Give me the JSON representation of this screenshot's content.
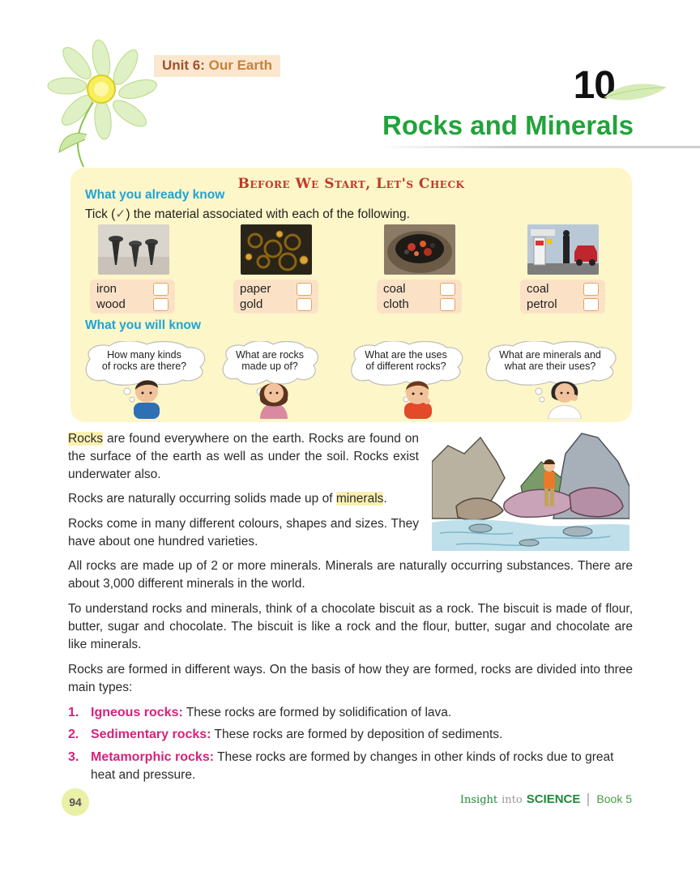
{
  "header": {
    "unit_label": "Unit 6:",
    "unit_name": "Our Earth",
    "chapter_number": "10",
    "chapter_title": "Rocks and Minerals"
  },
  "check_section": {
    "heading": "Before We Start, Let's Check",
    "already_know_heading": "What you already know",
    "instruction_before": "Tick (",
    "instruction_tick": "✓",
    "instruction_after": ") the material associated with each of the following.",
    "items": [
      {
        "options": [
          "iron",
          "wood"
        ],
        "photo_icon": "nails-photo-icon"
      },
      {
        "options": [
          "paper",
          "gold"
        ],
        "photo_icon": "jewellery-photo-icon"
      },
      {
        "options": [
          "coal",
          "cloth"
        ],
        "photo_icon": "coal-stove-photo-icon"
      },
      {
        "options": [
          "coal",
          "petrol"
        ],
        "photo_icon": "fuel-pump-photo-icon"
      }
    ],
    "will_know_heading": "What you will know",
    "questions": [
      {
        "line1": "How many kinds",
        "line2": "of rocks are there?"
      },
      {
        "line1": "What are rocks",
        "line2": "made up of?"
      },
      {
        "line1": "What are the uses",
        "line2": "of different rocks?"
      },
      {
        "line1": "What are minerals and",
        "line2": "what are their uses?"
      }
    ]
  },
  "body": {
    "p1_term": "Rocks",
    "p1_rest": " are found everywhere on the earth. Rocks are found on the surface of the earth as well as under the soil. Rocks exist underwater also.",
    "p2_before": "Rocks are naturally occurring solids made up of ",
    "p2_term": "minerals",
    "p2_after": ".",
    "p3": "Rocks come in many different colours, shapes and sizes. They have about one hundred varieties.",
    "p4": "All rocks are made up of 2 or more minerals. Minerals are naturally occurring substances. There are about 3,000 different minerals in the world.",
    "p5": "To understand rocks and minerals, think of a chocolate biscuit as a rock. The biscuit is made of flour, butter, sugar and chocolate. The biscuit is like a rock and the flour, butter, sugar and chocolate are like minerals.",
    "p6": "Rocks are formed in different ways. On the basis of how they are formed, rocks are divided into three main types:",
    "types": [
      {
        "num": "1.",
        "term": "Igneous rocks:",
        "desc": " These rocks are formed by solidification of lava."
      },
      {
        "num": "2.",
        "term": "Sedimentary rocks:",
        "desc": " These rocks are formed by deposition of sediments."
      },
      {
        "num": "3.",
        "term": "Metamorphic rocks:",
        "desc": " These rocks are formed by changes in other kinds of rocks due to great heat and pressure."
      }
    ]
  },
  "footer": {
    "page_number": "94",
    "series_1": "Insight",
    "series_2": "into",
    "series_3": "SCIENCE",
    "book": "Book 5"
  },
  "colors": {
    "title_green": "#22a33a",
    "heading_red": "#c0392b",
    "heading_blue": "#1fa3d7",
    "term_magenta": "#d6237a",
    "box_yellow": "#fdf6c8"
  }
}
